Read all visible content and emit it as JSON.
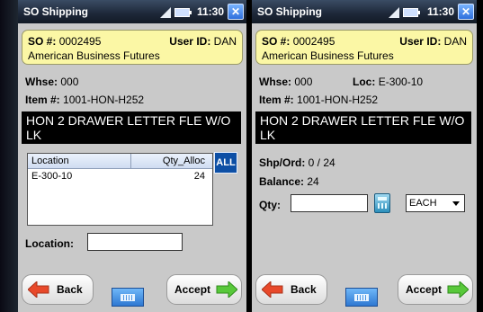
{
  "statusbar": {
    "app_title": "SO Shipping",
    "time": "11:30",
    "close_glyph": "✕"
  },
  "order": {
    "so_label": "SO #:",
    "so_number": "0002495",
    "user_label": "User ID:",
    "user_id": "DAN",
    "customer": "American Business Futures"
  },
  "pick": {
    "whse_label": "Whse:",
    "whse_value": "000",
    "item_label": "Item #:",
    "item_value": "1001-HON-H252",
    "description": "HON 2 DRAWER LETTER FLE W/O LK",
    "grid": {
      "headers": [
        "Location",
        "Qty_Alloc"
      ],
      "rows": [
        {
          "location": "E-300-10",
          "qty": "24"
        }
      ]
    },
    "all_label": "ALL",
    "location_label": "Location:",
    "location_value": ""
  },
  "detail": {
    "whse_label": "Whse:",
    "whse_value": "000",
    "loc_label": "Loc:",
    "loc_value": "E-300-10",
    "item_label": "Item #:",
    "item_value": "1001-HON-H252",
    "description": "HON 2 DRAWER LETTER FLE W/O LK",
    "shp_label": "Shp/Ord:",
    "shp_value": "0 / 24",
    "balance_label": "Balance:",
    "balance_value": "24",
    "qty_label": "Qty:",
    "qty_value": "",
    "uom_value": "EACH"
  },
  "buttons": {
    "back": "Back",
    "accept": "Accept"
  },
  "colors": {
    "header_box": "#fbf7a5",
    "back_arrow": "#e8492a",
    "accept_arrow": "#58c83a",
    "all_button": "#0d4fa5"
  },
  "icons": {
    "back": "left-arrow-icon",
    "accept": "right-arrow-icon",
    "keyboard": "keyboard-icon",
    "calculator": "calculator-icon",
    "signal": "signal-icon",
    "battery": "battery-icon",
    "close": "close-icon"
  }
}
